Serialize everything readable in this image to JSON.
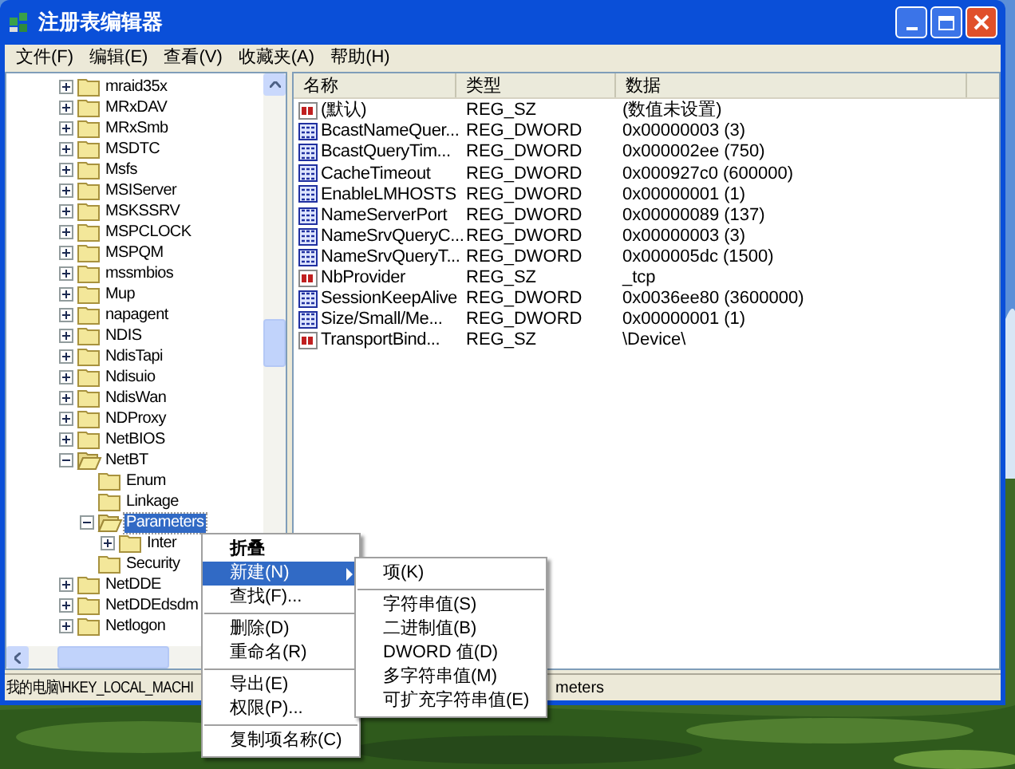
{
  "window": {
    "title": "注册表编辑器"
  },
  "menu": [
    {
      "label": "文件(F)"
    },
    {
      "label": "编辑(E)"
    },
    {
      "label": "查看(V)"
    },
    {
      "label": "收藏夹(A)"
    },
    {
      "label": "帮助(H)"
    }
  ],
  "tree": [
    {
      "label": "mraid35x",
      "expanded": false,
      "selected": false
    },
    {
      "label": "MRxDAV",
      "expanded": false,
      "selected": false
    },
    {
      "label": "MRxSmb",
      "expanded": false,
      "selected": false
    },
    {
      "label": "MSDTC",
      "expanded": false,
      "selected": false
    },
    {
      "label": "Msfs",
      "expanded": false,
      "selected": false
    },
    {
      "label": "MSIServer",
      "expanded": false,
      "selected": false
    },
    {
      "label": "MSKSSRV",
      "expanded": false,
      "selected": false
    },
    {
      "label": "MSPCLOCK",
      "expanded": false,
      "selected": false
    },
    {
      "label": "MSPQM",
      "expanded": false,
      "selected": false
    },
    {
      "label": "mssmbios",
      "expanded": false,
      "selected": false
    },
    {
      "label": "Mup",
      "expanded": false,
      "selected": false
    },
    {
      "label": "napagent",
      "expanded": false,
      "selected": false
    },
    {
      "label": "NDIS",
      "expanded": false,
      "selected": false
    },
    {
      "label": "NdisTapi",
      "expanded": false,
      "selected": false
    },
    {
      "label": "Ndisuio",
      "expanded": false,
      "selected": false
    },
    {
      "label": "NdisWan",
      "expanded": false,
      "selected": false
    },
    {
      "label": "NDProxy",
      "expanded": false,
      "selected": false
    },
    {
      "label": "NetBIOS",
      "expanded": false,
      "selected": false
    },
    {
      "label": "NetBT",
      "expanded": true,
      "selected": false,
      "children": [
        {
          "label": "Enum",
          "selected": false
        },
        {
          "label": "Linkage",
          "selected": false
        },
        {
          "label": "Parameters",
          "expanded": true,
          "selected": true,
          "children": [
            {
              "label": "Inter",
              "expanded": false,
              "selected": false
            }
          ]
        },
        {
          "label": "Security",
          "selected": false
        }
      ]
    },
    {
      "label": "NetDDE",
      "expanded": false,
      "selected": false
    },
    {
      "label": "NetDDEdsdm",
      "expanded": false,
      "selected": false
    },
    {
      "label": "Netlogon",
      "expanded": false,
      "selected": false
    }
  ],
  "list": {
    "columns": [
      "名称",
      "类型",
      "数据"
    ],
    "rows": [
      {
        "kind": "string",
        "name": "(默认)",
        "type": "REG_SZ",
        "data": "(数值未设置)"
      },
      {
        "kind": "dword",
        "name": "BcastNameQuer...",
        "type": "REG_DWORD",
        "data": "0x00000003 (3)"
      },
      {
        "kind": "dword",
        "name": "BcastQueryTim...",
        "type": "REG_DWORD",
        "data": "0x000002ee (750)"
      },
      {
        "kind": "dword",
        "name": "CacheTimeout",
        "type": "REG_DWORD",
        "data": "0x000927c0 (600000)"
      },
      {
        "kind": "dword",
        "name": "EnableLMHOSTS",
        "type": "REG_DWORD",
        "data": "0x00000001 (1)"
      },
      {
        "kind": "dword",
        "name": "NameServerPort",
        "type": "REG_DWORD",
        "data": "0x00000089 (137)"
      },
      {
        "kind": "dword",
        "name": "NameSrvQueryC...",
        "type": "REG_DWORD",
        "data": "0x00000003 (3)"
      },
      {
        "kind": "dword",
        "name": "NameSrvQueryT...",
        "type": "REG_DWORD",
        "data": "0x000005dc (1500)"
      },
      {
        "kind": "string",
        "name": "NbProvider",
        "type": "REG_SZ",
        "data": "_tcp"
      },
      {
        "kind": "dword",
        "name": "SessionKeepAlive",
        "type": "REG_DWORD",
        "data": "0x0036ee80 (3600000)"
      },
      {
        "kind": "dword",
        "name": "Size/Small/Me...",
        "type": "REG_DWORD",
        "data": "0x00000001 (1)"
      },
      {
        "kind": "string",
        "name": "TransportBind...",
        "type": "REG_SZ",
        "data": "\\Device\\"
      }
    ]
  },
  "status_bar": {
    "path_start": "我的电脑\\HKEY_LOCAL_MACHI",
    "path_end": "meters"
  },
  "context_menu": [
    {
      "kind": "item",
      "label": "折叠",
      "bold": true,
      "selected": false,
      "submenu": false
    },
    {
      "kind": "item",
      "label": "新建(N)",
      "bold": false,
      "selected": true,
      "submenu": true
    },
    {
      "kind": "item",
      "label": "查找(F)...",
      "bold": false,
      "selected": false,
      "submenu": false
    },
    {
      "kind": "separator"
    },
    {
      "kind": "item",
      "label": "删除(D)",
      "bold": false,
      "selected": false,
      "submenu": false
    },
    {
      "kind": "item",
      "label": "重命名(R)",
      "bold": false,
      "selected": false,
      "submenu": false
    },
    {
      "kind": "separator"
    },
    {
      "kind": "item",
      "label": "导出(E)",
      "bold": false,
      "selected": false,
      "submenu": false
    },
    {
      "kind": "item",
      "label": "权限(P)...",
      "bold": false,
      "selected": false,
      "submenu": false
    },
    {
      "kind": "separator"
    },
    {
      "kind": "item",
      "label": "复制项名称(C)",
      "bold": false,
      "selected": false,
      "submenu": false
    }
  ],
  "submenu": [
    {
      "kind": "item",
      "label": "项(K)"
    },
    {
      "kind": "separator"
    },
    {
      "kind": "item",
      "label": "字符串值(S)"
    },
    {
      "kind": "item",
      "label": "二进制值(B)"
    },
    {
      "kind": "item",
      "label": "DWORD 值(D)"
    },
    {
      "kind": "item",
      "label": "多字符串值(M)"
    },
    {
      "kind": "item",
      "label": "可扩充字符串值(E)"
    }
  ]
}
